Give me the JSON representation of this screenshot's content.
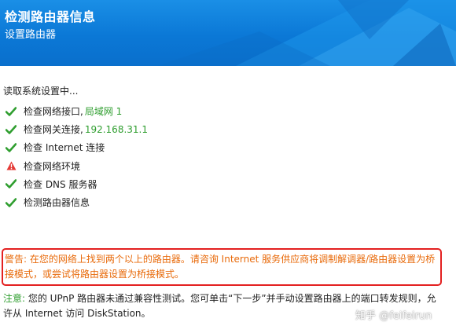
{
  "header": {
    "title": "检测路由器信息",
    "subtitle": "设置路由器"
  },
  "colors": {
    "header_blue": "#0b78d6",
    "success_green": "#2f9e2f",
    "warning_red": "#e32020",
    "warning_text_orange": "#e86a0a"
  },
  "status": {
    "reading": "读取系统设置中..."
  },
  "checks": [
    {
      "icon": "check-icon",
      "label": "检查网络接口, ",
      "value": "局域网 1"
    },
    {
      "icon": "check-icon",
      "label": "检查网关连接, ",
      "value": "192.168.31.1"
    },
    {
      "icon": "check-icon",
      "label": "检查 Internet 连接",
      "value": ""
    },
    {
      "icon": "warning-icon",
      "label": "检查网络环境",
      "value": ""
    },
    {
      "icon": "check-icon",
      "label": "检查 DNS 服务器",
      "value": ""
    },
    {
      "icon": "check-icon",
      "label": "检测路由器信息",
      "value": ""
    }
  ],
  "warning": {
    "text": "警告: 在您的网络上找到两个以上的路由器。请咨询 Internet 服务供应商将调制解调器/路由器设置为桥接模式，或尝试将路由器设置为桥接模式。"
  },
  "note": {
    "label": "注意:",
    "text": " 您的 UPnP 路由器未通过兼容性测试。您可单击“下一步”并手动设置路由器上的端口转发规则，允许从 Internet 访问 DiskStation。"
  },
  "watermark": {
    "text": "知乎 @feifeirun"
  }
}
